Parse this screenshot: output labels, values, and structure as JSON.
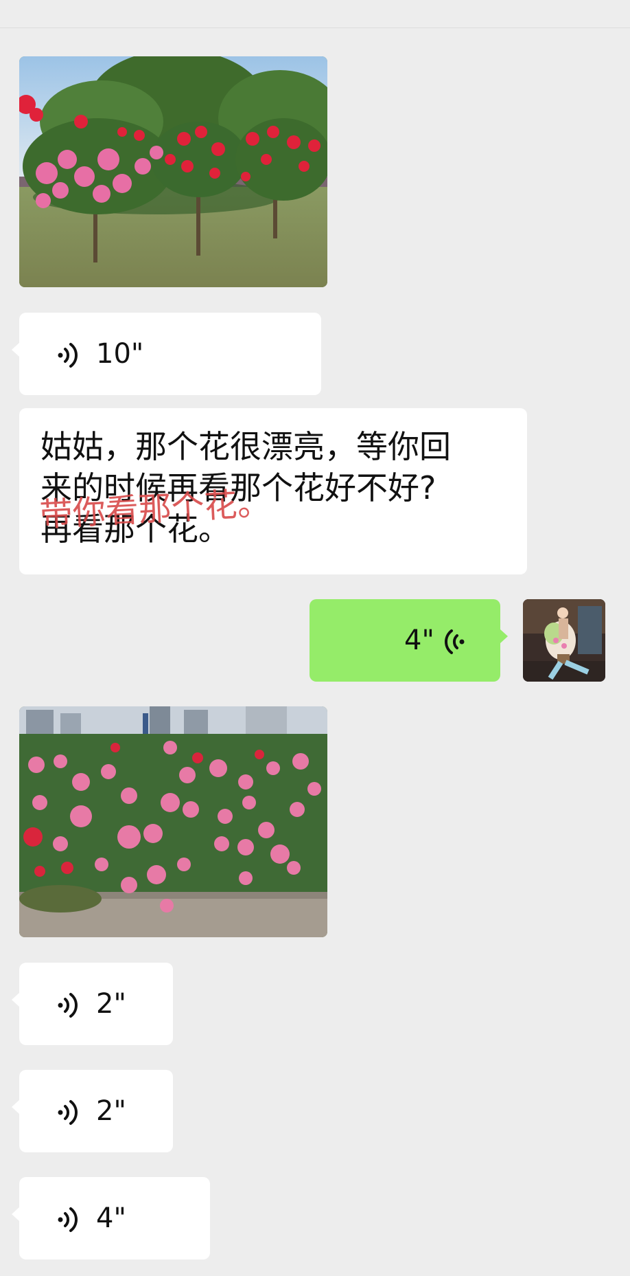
{
  "messages": [
    {
      "type": "image",
      "from": "them",
      "subject": "standard-rose-trees"
    },
    {
      "type": "voice",
      "from": "them",
      "duration": "10\""
    },
    {
      "type": "text",
      "from": "them",
      "lines": [
        "姑姑，那个花很漂亮，等你回",
        "来的时候再看那个花好不好?",
        "再看那个花。"
      ],
      "overlay": "带你看那个花。"
    },
    {
      "type": "voice",
      "from": "me",
      "duration": "4\""
    },
    {
      "type": "image",
      "from": "them",
      "subject": "pink-rose-bushes"
    },
    {
      "type": "voice",
      "from": "them",
      "duration": "2\""
    },
    {
      "type": "voice",
      "from": "them",
      "duration": "2\""
    },
    {
      "type": "voice",
      "from": "them",
      "duration": "4\""
    }
  ],
  "colors": {
    "background": "#ededed",
    "bubble_left": "#ffffff",
    "bubble_right": "#95ec69",
    "overlay_text": "#d84a4a"
  },
  "icons": {
    "voice_left": "voice-wave-icon",
    "voice_right": "voice-wave-icon"
  }
}
